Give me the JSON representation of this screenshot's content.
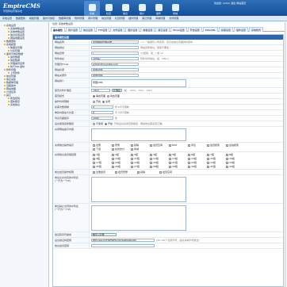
{
  "header": {
    "logo": "EmpireCMS",
    "logo_sub": "帝国网站管理系统",
    "welcome": "欢迎您: admin  退出  网站首页",
    "icons": [
      {
        "label": "系统",
        "active": true
      },
      {
        "label": "栏目",
        "active": false
      },
      {
        "label": "信息",
        "active": false
      },
      {
        "label": "用户",
        "active": false
      },
      {
        "label": "插件",
        "active": false
      },
      {
        "label": "商城",
        "active": false
      }
    ]
  },
  "menu": [
    "系统设置",
    "数据更新",
    "模板管理",
    "备份与恢复",
    "数据库管理",
    "附件管理",
    "用户管理",
    "信息管理",
    "栏目管理",
    "插件管理",
    "其它管理",
    "商城管理",
    "文件管理"
  ],
  "sidebar": [
    {
      "label": "系统设置",
      "level": 1
    },
    {
      "label": "系统参数设置",
      "level": 2
    },
    {
      "label": "系统参数设置",
      "level": 2
    },
    {
      "label": "信息反馈设置",
      "level": 2
    },
    {
      "label": "网站地图设置",
      "level": 2
    },
    {
      "label": "数据更新",
      "level": 1
    },
    {
      "label": "系统模型",
      "level": 1
    },
    {
      "label": "数据表管理",
      "level": 2
    },
    {
      "label": "分表管理",
      "level": 2
    },
    {
      "label": "备份与恢复数据",
      "level": 1
    },
    {
      "label": "备份数据",
      "level": 2
    },
    {
      "label": "恢复数据",
      "level": 2
    },
    {
      "label": "管理备份目录",
      "level": 2
    },
    {
      "label": "执行SQL语句",
      "level": 2
    },
    {
      "label": "附件管理",
      "level": 1
    },
    {
      "label": "上传附件",
      "level": 2
    },
    {
      "label": "前台管理",
      "level": 1
    },
    {
      "label": "信息采集",
      "level": 1
    },
    {
      "label": "数据库管理",
      "level": 1
    },
    {
      "label": "远程发布",
      "level": 1
    },
    {
      "label": "网站地图",
      "level": 1
    },
    {
      "label": "计划任务",
      "level": 1
    },
    {
      "label": "其它",
      "level": 1
    },
    {
      "label": "修改密码",
      "level": 2
    },
    {
      "label": "更新缓存",
      "level": 2
    },
    {
      "label": "系统信息",
      "level": 2
    }
  ],
  "breadcrumb": "位置: 系统参数设置",
  "tabs": [
    "基本属性",
    "用户设置",
    "信息设置",
    "FTP设置",
    "文件设置",
    "图片设置",
    "模板设置",
    "其它设置",
    "Email设置",
    "开启设置",
    "RSS/XML",
    "投票设置",
    "插件设置",
    "系统模式"
  ],
  "form_title": "基本属性设置",
  "rows": [
    {
      "label": "网站名称",
      "value": "帝国网站管理系统",
      "hint": "<< 一般填写公司名称，显示在前台页面的标题中"
    },
    {
      "label": "网站地址",
      "value": "",
      "hint": "网站完整地址，结尾不要加 /"
    },
    {
      "label": "网站目录",
      "value": "/",
      "hint": "以/结尾，如：/ 或 /e/"
    },
    {
      "label": "附件地址",
      "value": "/d/file/",
      "hint": "附件访问地址，如：http://"
    },
    {
      "label": "管理员Email",
      "value": "admin@yoursite.com",
      "hint": ""
    },
    {
      "label": "网站标题",
      "value": "帝国CMS",
      "hint": ""
    },
    {
      "label": "网站关键字",
      "value": "帝国CMS",
      "hint": ""
    },
    {
      "label": "网站简介",
      "value": "帝国CMS",
      "hint": ""
    }
  ],
  "filetype": {
    "label": "首页文件扩展名",
    "value": ".html",
    "select": "扩展名",
    "hint": "(如：.html，.htm，.php)"
  },
  "pagemode": {
    "label": "首页模式",
    "options": [
      "静态页面",
      "动态页面"
    ]
  },
  "vote": {
    "label": "操作时间限制",
    "options": [
      "开启",
      "关闭"
    ]
  },
  "count": {
    "label": "投票次数限制",
    "value": "0",
    "hint": "秒 0为不限制"
  },
  "maxsize": {
    "label": "单篇内容最大长度",
    "value": "0",
    "hint": "字 0为不限制"
  },
  "ltime": {
    "label": "列表页面缓存",
    "value": "1000",
    "hint": "秒"
  },
  "bakmode": {
    "label": "后台使用完整路径",
    "options": [
      "不使用",
      "开启"
    ],
    "hint": "开启后台采用完整路径，网站地址需设置正确。"
  },
  "closeinfo": {
    "label": "关闭网站提示内容"
  },
  "checkitems": {
    "label": "关闭前台操作提示",
    "items": [
      "注册",
      "登录",
      "投稿",
      "会员空间",
      "RSS",
      "评论",
      "会员搜索",
      "全站搜索",
      "下载",
      "在线支付",
      "商城"
    ]
  },
  "groups": {
    "label": "关闭前台会员组权限",
    "items": [
      "1组",
      "2组",
      "3组",
      "4组",
      "5组",
      "6组",
      "7组",
      "8组",
      "9组",
      "10组",
      "11组",
      "12组",
      "13组",
      "14组",
      "15组",
      "16组",
      "17组",
      "18组",
      "19组",
      "20组",
      "21组",
      "22组",
      "23组",
      "24组",
      "25组",
      "26组",
      "27组",
      "28组",
      "29组",
      "30组",
      "31组",
      "32组"
    ]
  },
  "reg": {
    "label": "前台会员操作权限",
    "items": [
      "注册会员",
      "会员登录",
      "投稿",
      "会员空间"
    ]
  },
  "ipallow": {
    "label": "前台允许访问的IP列表",
    "sub": "(一行为一个IP)"
  },
  "ipdeny": {
    "label": "前台禁止访问的IP列表",
    "sub": "(一行为一个IP)"
  },
  "timeout": {
    "label": "验证码字符组成",
    "value": "数字+字母",
    "hint": ""
  },
  "key": {
    "label": "后台验证码密钥",
    "value": "EMY/eGUxYH9Ft6f5/CAC5a60q8ooEu",
    "hint": "(10~60个任意字符，最好多种字符组合)"
  },
  "salt": {
    "label": "前台会员密钥",
    "value": "",
    "hint": ""
  }
}
